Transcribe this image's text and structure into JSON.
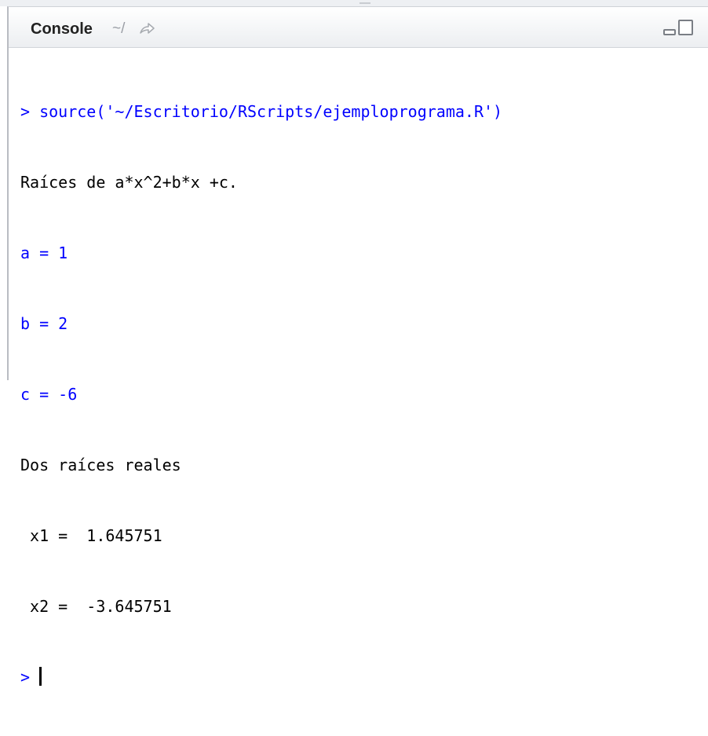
{
  "header": {
    "title": "Console",
    "path": "~/",
    "goto_icon": "arrow-goto-icon",
    "minimize_icon": "minimize-icon",
    "maximize_icon": "maximize-icon"
  },
  "console": {
    "command": "> source('~/Escritorio/RScripts/ejemploprograma.R')",
    "lines": [
      "Raíces de a*x^2+b*x +c.",
      "a = 1",
      "b = 2",
      "c = -6",
      "Dos raíces reales",
      " x1 =  1.645751",
      " x2 =  -3.645751"
    ],
    "prompt": "> "
  },
  "colors": {
    "input": "#0000ff",
    "output": "#000000"
  }
}
